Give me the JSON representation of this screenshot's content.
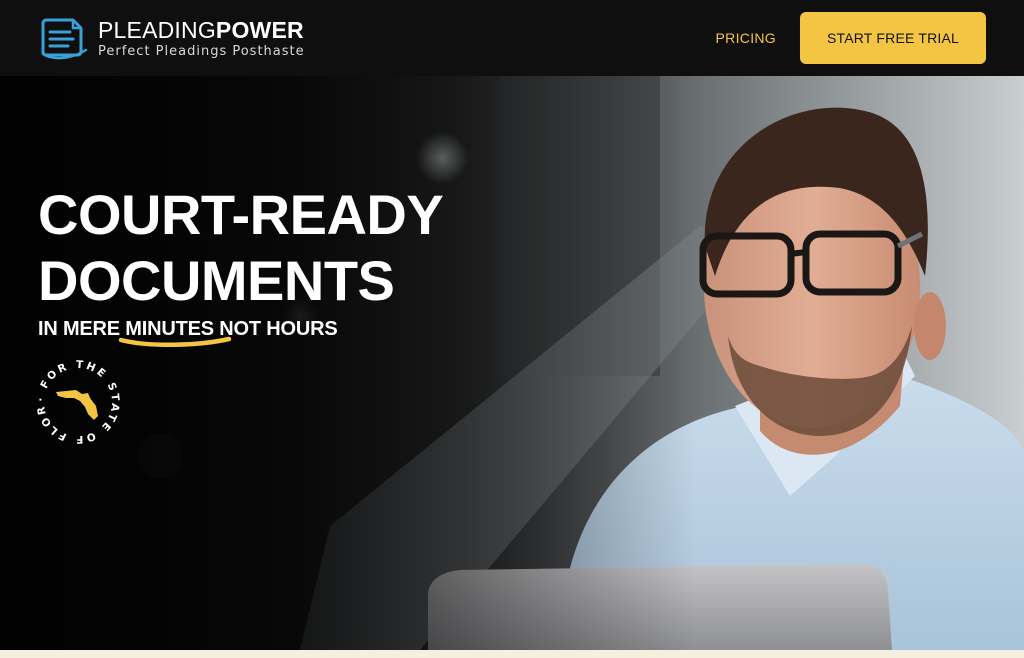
{
  "header": {
    "brand": {
      "name_light": "PLEADING",
      "name_bold": "POWER",
      "tagline": "Perfect Pleadings Posthaste",
      "logo_icon": "document-icon"
    },
    "nav": {
      "pricing_label": "PRICING"
    },
    "cta_label": "START FREE TRIAL"
  },
  "hero": {
    "headline_line1": "COURT-READY",
    "headline_line2": "DOCUMENTS",
    "subhead_pre": "IN MERE ",
    "subhead_highlight": "MINUTES NOT",
    "subhead_post": " HOURS",
    "badge": {
      "text": "· FOR THE STATE OF FLORIDA",
      "icon": "florida-map-icon"
    }
  },
  "colors": {
    "accent": "#f4c542",
    "header_bg": "#0f0f0f",
    "logo_blue": "#3aa0d8",
    "text": "#ffffff"
  }
}
